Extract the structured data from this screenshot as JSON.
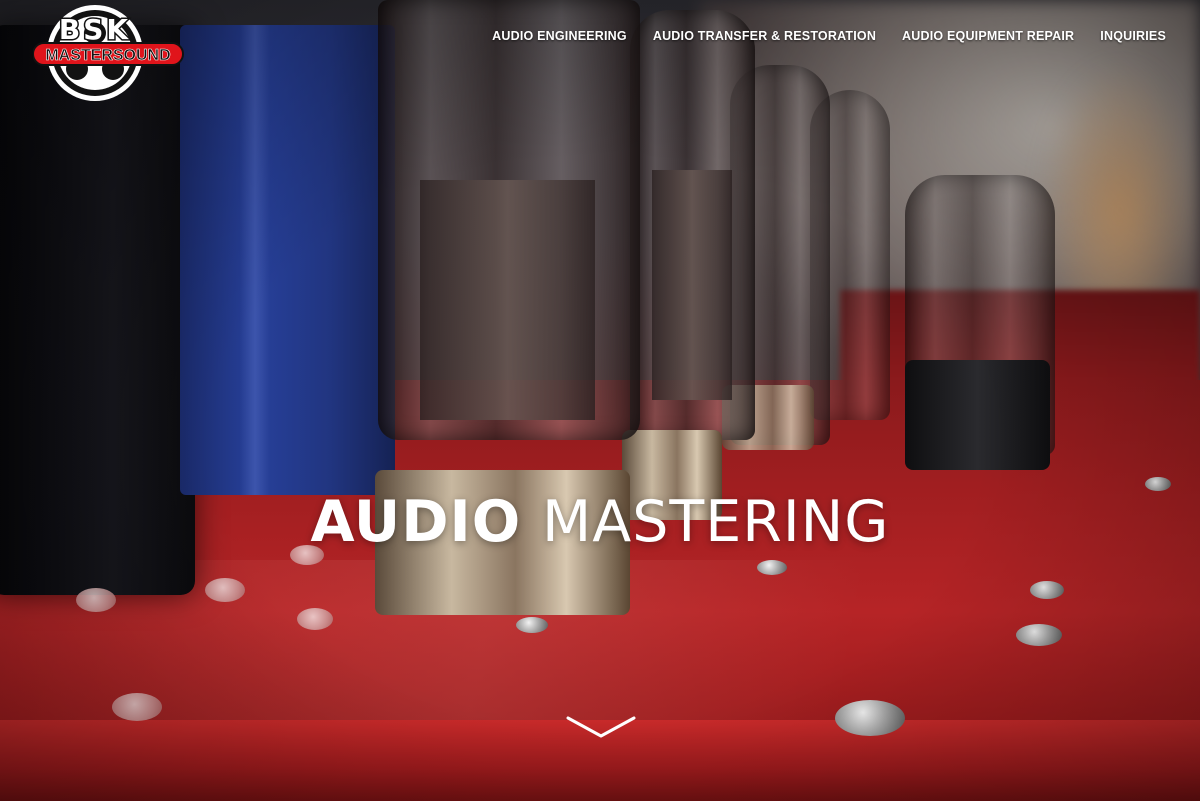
{
  "brand": {
    "logo_top_text": "BSK",
    "logo_band_text": "MASTERSOUND",
    "colors": {
      "band": "#e0141b",
      "ring": "#111111"
    }
  },
  "nav": {
    "items": [
      {
        "label": "AUDIO ENGINEERING"
      },
      {
        "label": "AUDIO TRANSFER & RESTORATION"
      },
      {
        "label": "AUDIO EQUIPMENT REPAIR"
      },
      {
        "label": "INQUIRIES"
      }
    ]
  },
  "hero": {
    "title_bold": "AUDIO",
    "title_light": "MASTERING",
    "scroll_icon": "chevron-down-icon"
  },
  "background": {
    "subject": "vacuum tube amplifier on red chassis",
    "accent": "#a01e20"
  }
}
